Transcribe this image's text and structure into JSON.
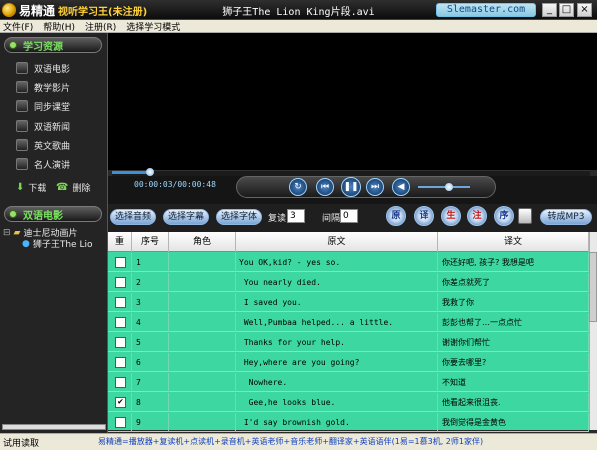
{
  "window": {
    "logo_name": "易精通",
    "logo_subtitle": "视听学习王(未注册)",
    "title": "狮子王The Lion King片段.avi",
    "site_badge": "Slemaster.com",
    "min": "_",
    "max": "□",
    "close": "×"
  },
  "menu": [
    "文件(F)",
    "帮助(H)",
    "注册(R)",
    "选择学习模式"
  ],
  "sidebar": {
    "section1": "学习资源",
    "items": [
      {
        "label": "双语电影",
        "icon": "film-icon"
      },
      {
        "label": "教学影片",
        "icon": "video-icon"
      },
      {
        "label": "同步课堂",
        "icon": "classroom-icon"
      },
      {
        "label": "双语新闻",
        "icon": "news-icon"
      },
      {
        "label": "英文歌曲",
        "icon": "music-icon"
      },
      {
        "label": "名人演讲",
        "icon": "speech-icon"
      }
    ],
    "download": "下载",
    "delete": "删除",
    "section2": "双语电影",
    "tree": {
      "folder": "迪士尼动画片",
      "child": "狮子王The Lio"
    }
  },
  "player": {
    "time": "00:00:03/00:00:48",
    "progress": 0.08,
    "volume": 0.6
  },
  "toolbar": {
    "select_audio": "选择音频",
    "select_subtitle": "选择字幕",
    "select_font": "选择字体",
    "repeat_label": "复读",
    "repeat_value": "3",
    "interval_label": "间隔",
    "interval_value": "0",
    "btn_original": "原",
    "btn_translation": "译",
    "btn_new": "生",
    "btn_note": "注",
    "btn_sequence": "序",
    "mp3": "转成MP3"
  },
  "table": {
    "headers": [
      "重",
      "序号",
      "角色",
      "原文",
      "译文"
    ],
    "rows": [
      {
        "checked": false,
        "num": "1",
        "role": "",
        "original": "You OK,kid? - yes so.",
        "translation": "你还好吧, 孩子? 我想是吧"
      },
      {
        "checked": false,
        "num": "2",
        "role": "",
        "original": " You nearly died.",
        "translation": "你差点就死了"
      },
      {
        "checked": false,
        "num": "3",
        "role": "",
        "original": " I saved you.",
        "translation": "我救了你"
      },
      {
        "checked": false,
        "num": "4",
        "role": "",
        "original": " Well,Pumbaa helped... a little.",
        "translation": "彭彭也帮了…一点点忙"
      },
      {
        "checked": false,
        "num": "5",
        "role": "",
        "original": " Thanks for your help.",
        "translation": "谢谢你们帮忙"
      },
      {
        "checked": false,
        "num": "6",
        "role": "",
        "original": " Hey,where are you going?",
        "translation": "你要去哪里?"
      },
      {
        "checked": false,
        "num": "7",
        "role": "",
        "original": "  Nowhere.",
        "translation": "不知道"
      },
      {
        "checked": true,
        "num": "8",
        "role": "",
        "original": "  Gee,he looks blue.",
        "translation": "他看起来很沮丧."
      },
      {
        "checked": false,
        "num": "9",
        "role": "",
        "original": " I'd say brownish gold.",
        "translation": "我倒觉得是金黄色"
      }
    ]
  },
  "status": {
    "left": "试用读取",
    "marquee": "易精通=播放器+复读机+点读机+录音机+英语老师+音乐老师+翻译家+英语语伴(1易=1慕3机, 2师1家伴)"
  }
}
